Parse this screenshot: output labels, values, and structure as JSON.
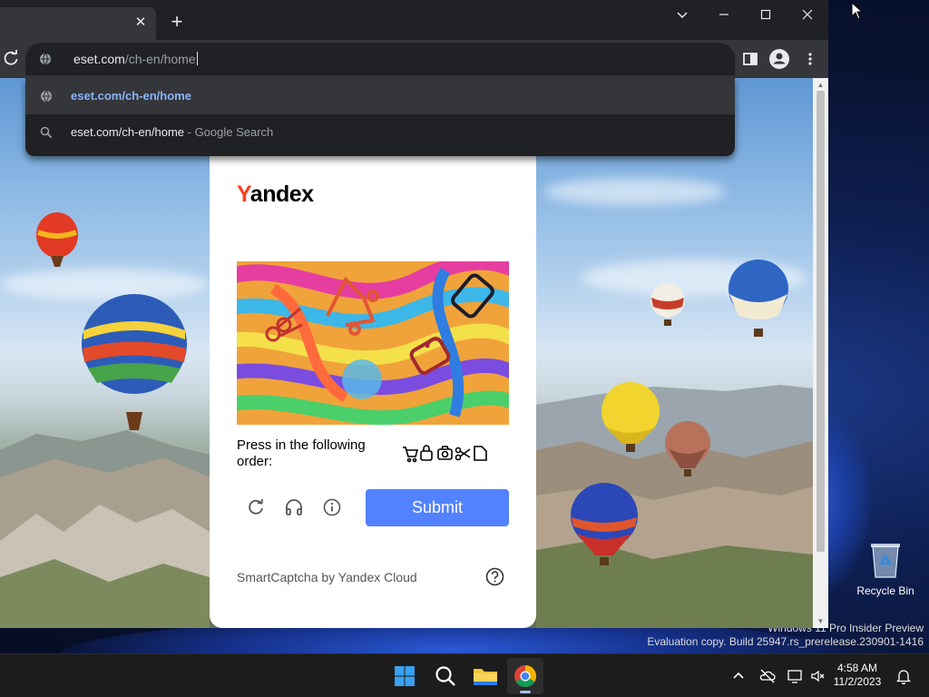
{
  "browser": {
    "tab": {
      "close_label": "✕"
    },
    "newtab_label": "+",
    "controls": {
      "dropdown": "⌄",
      "minimize": "—",
      "maximize": "▢",
      "close": "✕"
    },
    "address": {
      "value_host": "eset.com",
      "value_path": "/ch-en/home"
    },
    "suggestions": [
      {
        "icon": "globe-icon",
        "text": "eset.com/ch-en/home",
        "sub": ""
      },
      {
        "icon": "search-icon",
        "text": "eset.com/ch-en/home",
        "sub": " - Google Search"
      }
    ]
  },
  "captcha": {
    "logo_first": "Y",
    "logo_rest": "andex",
    "instruction": "Press in the following order:",
    "order_icons": [
      "cart-icon",
      "lock-icon",
      "camera-icon",
      "scissors-icon",
      "note-icon"
    ],
    "submit_label": "Submit",
    "footer": "SmartCaptcha by Yandex Cloud"
  },
  "desktop": {
    "recycle_bin_label": "Recycle Bin",
    "watermark_line1": "Windows 11 Pro Insider Preview",
    "watermark_line2": "Evaluation copy. Build 25947.rs_prerelease.230901-1416"
  },
  "taskbar": {
    "apps": [
      "start-button",
      "search-button",
      "file-explorer",
      "chrome"
    ],
    "time": "4:58 AM",
    "date": "11/2/2023"
  },
  "colors": {
    "brand_red": "#fc3f1d",
    "submit_blue": "#5282ff",
    "link_blue": "#8ab4f8",
    "chrome_dark": "#202124"
  }
}
